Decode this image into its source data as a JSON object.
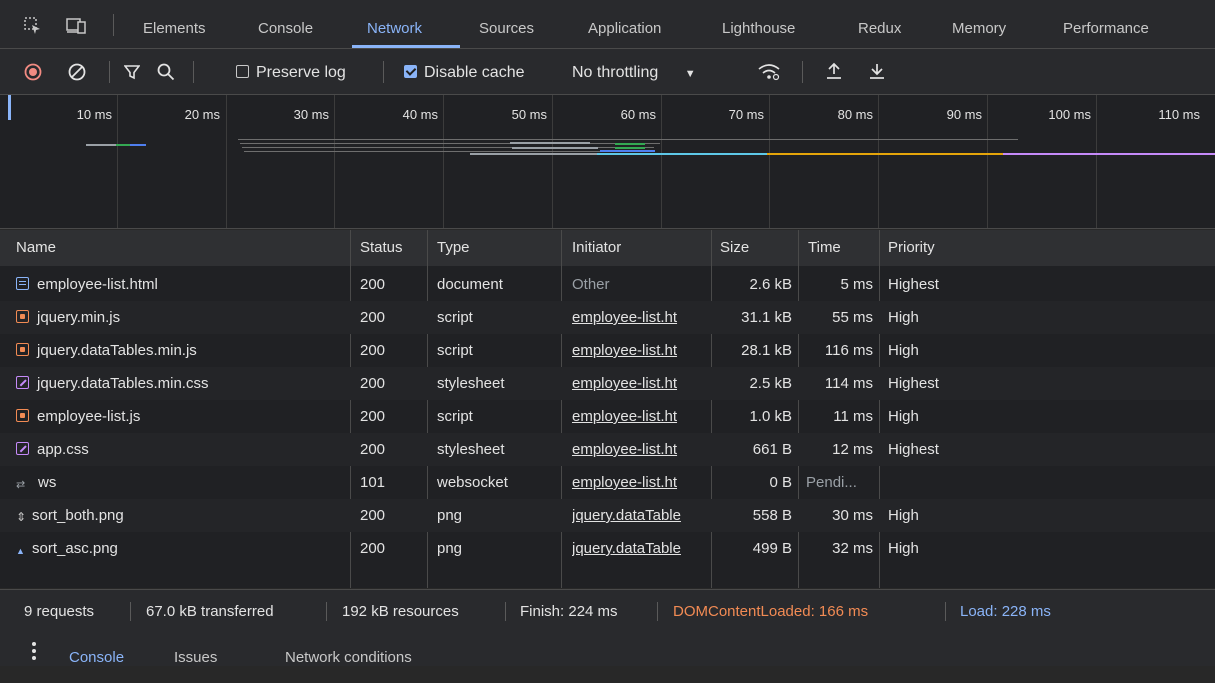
{
  "tabs": [
    {
      "label": "Elements"
    },
    {
      "label": "Console"
    },
    {
      "label": "Network"
    },
    {
      "label": "Sources"
    },
    {
      "label": "Application"
    },
    {
      "label": "Lighthouse"
    },
    {
      "label": "Redux"
    },
    {
      "label": "Memory"
    },
    {
      "label": "Performance"
    }
  ],
  "active_tab": "Network",
  "toolbar": {
    "preserve_log": "Preserve log",
    "preserve_log_checked": false,
    "disable_cache": "Disable cache",
    "disable_cache_checked": true,
    "throttling": "No throttling"
  },
  "overview": {
    "ticks": [
      "10 ms",
      "20 ms",
      "30 ms",
      "40 ms",
      "50 ms",
      "60 ms",
      "70 ms",
      "80 ms",
      "90 ms",
      "100 ms",
      "110 ms"
    ]
  },
  "columns": {
    "name": "Name",
    "status": "Status",
    "type": "Type",
    "initiator": "Initiator",
    "size": "Size",
    "time": "Time",
    "priority": "Priority"
  },
  "requests": [
    {
      "icon": "document-icon",
      "name": "employee-list.html",
      "status": "200",
      "type": "document",
      "initiator": "Other",
      "size": "2.6 kB",
      "time": "5 ms",
      "priority": "Highest"
    },
    {
      "icon": "script-icon",
      "name": "jquery.min.js",
      "status": "200",
      "type": "script",
      "initiator": "employee-list.ht",
      "size": "31.1 kB",
      "time": "55 ms",
      "priority": "High"
    },
    {
      "icon": "script-icon",
      "name": "jquery.dataTables.min.js",
      "status": "200",
      "type": "script",
      "initiator": "employee-list.ht",
      "size": "28.1 kB",
      "time": "116 ms",
      "priority": "High"
    },
    {
      "icon": "stylesheet-icon",
      "name": "jquery.dataTables.min.css",
      "status": "200",
      "type": "stylesheet",
      "initiator": "employee-list.ht",
      "size": "2.5 kB",
      "time": "114 ms",
      "priority": "Highest"
    },
    {
      "icon": "script-icon",
      "name": "employee-list.js",
      "status": "200",
      "type": "script",
      "initiator": "employee-list.ht",
      "size": "1.0 kB",
      "time": "11 ms",
      "priority": "High"
    },
    {
      "icon": "stylesheet-icon",
      "name": "app.css",
      "status": "200",
      "type": "stylesheet",
      "initiator": "employee-list.ht",
      "size": "661 B",
      "time": "12 ms",
      "priority": "Highest"
    },
    {
      "icon": "websocket-icon",
      "name": "ws",
      "status": "101",
      "type": "websocket",
      "initiator": "employee-list.ht",
      "size": "0 B",
      "time": "Pendi...",
      "priority": ""
    },
    {
      "icon": "image-icon",
      "name": "sort_both.png",
      "status": "200",
      "type": "png",
      "initiator": "jquery.dataTable",
      "size": "558 B",
      "time": "30 ms",
      "priority": "High"
    },
    {
      "icon": "image-icon",
      "name": "sort_asc.png",
      "status": "200",
      "type": "png",
      "initiator": "jquery.dataTable",
      "size": "499 B",
      "time": "32 ms",
      "priority": "High"
    }
  ],
  "summary": {
    "requests": "9 requests",
    "transferred": "67.0 kB transferred",
    "resources": "192 kB resources",
    "finish": "Finish: 224 ms",
    "dcl": "DOMContentLoaded: 166 ms",
    "load": "Load: 228 ms"
  },
  "colors": {
    "dcl": "#f28b54",
    "load": "#8ab4f8",
    "accent": "#8ab4f8"
  },
  "drawer": {
    "tabs": [
      "Console",
      "Issues",
      "Network conditions"
    ]
  }
}
